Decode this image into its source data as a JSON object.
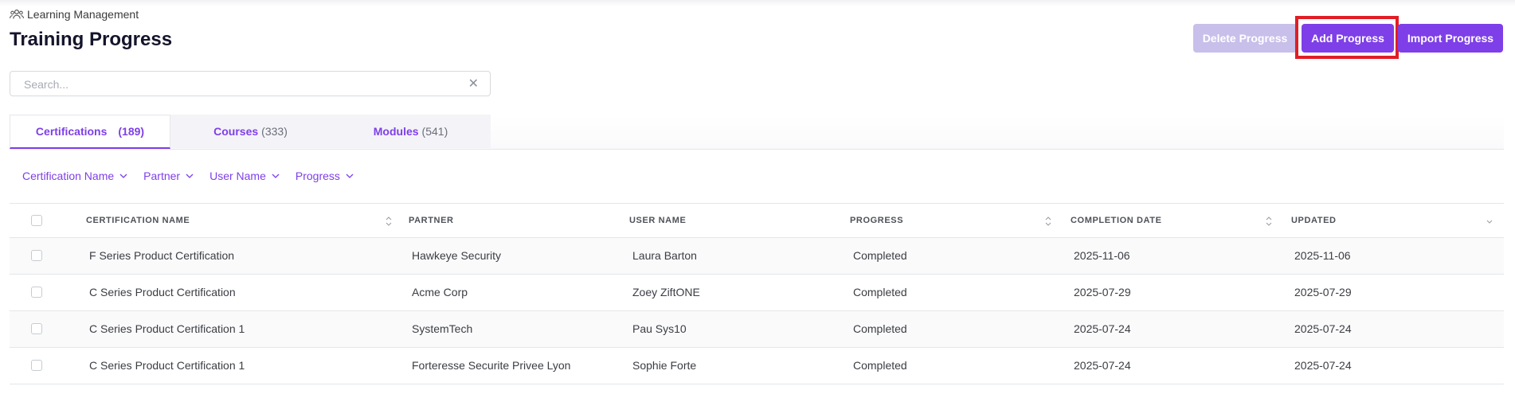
{
  "breadcrumb": {
    "label": "Learning Management",
    "icon": "users-icon"
  },
  "page": {
    "title": "Training Progress"
  },
  "actions": {
    "delete_label": "Delete Progress",
    "add_label": "Add Progress",
    "import_label": "Import Progress",
    "accent": "#7e3fe8",
    "highlight": "#e11d25"
  },
  "search": {
    "placeholder": "Search...",
    "value": ""
  },
  "tabs": [
    {
      "label": "Certifications",
      "count": "(189)"
    },
    {
      "label": "Courses",
      "count": "(333)"
    },
    {
      "label": "Modules",
      "count": "(541)"
    }
  ],
  "filters": [
    "Certification Name",
    "Partner",
    "User Name",
    "Progress"
  ],
  "table": {
    "columns": [
      "CERTIFICATION NAME",
      "PARTNER",
      "USER NAME",
      "PROGRESS",
      "COMPLETION DATE",
      "UPDATED"
    ],
    "rows": [
      [
        "F Series Product Certification",
        "Hawkeye Security",
        "Laura Barton",
        "Completed",
        "2025-11-06",
        "2025-11-06"
      ],
      [
        "C Series Product Certification",
        "Acme Corp",
        "Zoey ZiftONE",
        "Completed",
        "2025-07-29",
        "2025-07-29"
      ],
      [
        "C Series Product Certification 1",
        "SystemTech",
        "Pau Sys10",
        "Completed",
        "2025-07-24",
        "2025-07-24"
      ],
      [
        "C Series Product Certification 1",
        "Forteresse Securite Privee Lyon",
        "Sophie Forte",
        "Completed",
        "2025-07-24",
        "2025-07-24"
      ]
    ]
  }
}
